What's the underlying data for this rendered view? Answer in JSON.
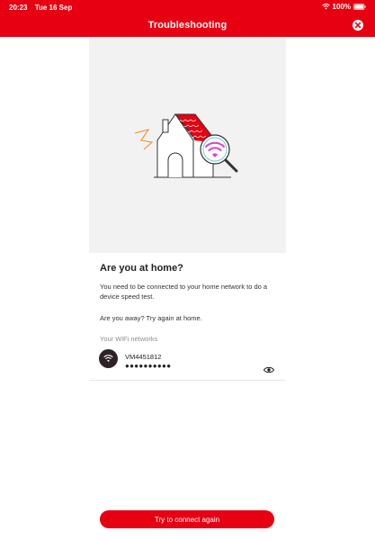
{
  "status_bar": {
    "time": "20:23",
    "date": "Tue 16 Sep",
    "battery": "100%"
  },
  "header": {
    "title": "Troubleshooting",
    "close_icon": "close-icon"
  },
  "hero": {
    "illustration": "house-wifi-magnifier-illustration",
    "accent_color": "#e60012",
    "wifi_color": "#e040c8"
  },
  "main": {
    "heading": "Are you at home?",
    "message": "You need to be connected to your home network to do a device speed test.",
    "away_message": "Are you away? Try again at home.",
    "networks_label": "Your WiFi networks"
  },
  "network": {
    "name": "VM4451812",
    "password_masked": "●●●●●●●●●●",
    "icon": "wifi-icon",
    "reveal_icon": "eye-icon"
  },
  "footer": {
    "connect_label": "Try to connect again"
  },
  "colors": {
    "brand": "#e60012",
    "hero_bg": "#f2f2f2"
  }
}
